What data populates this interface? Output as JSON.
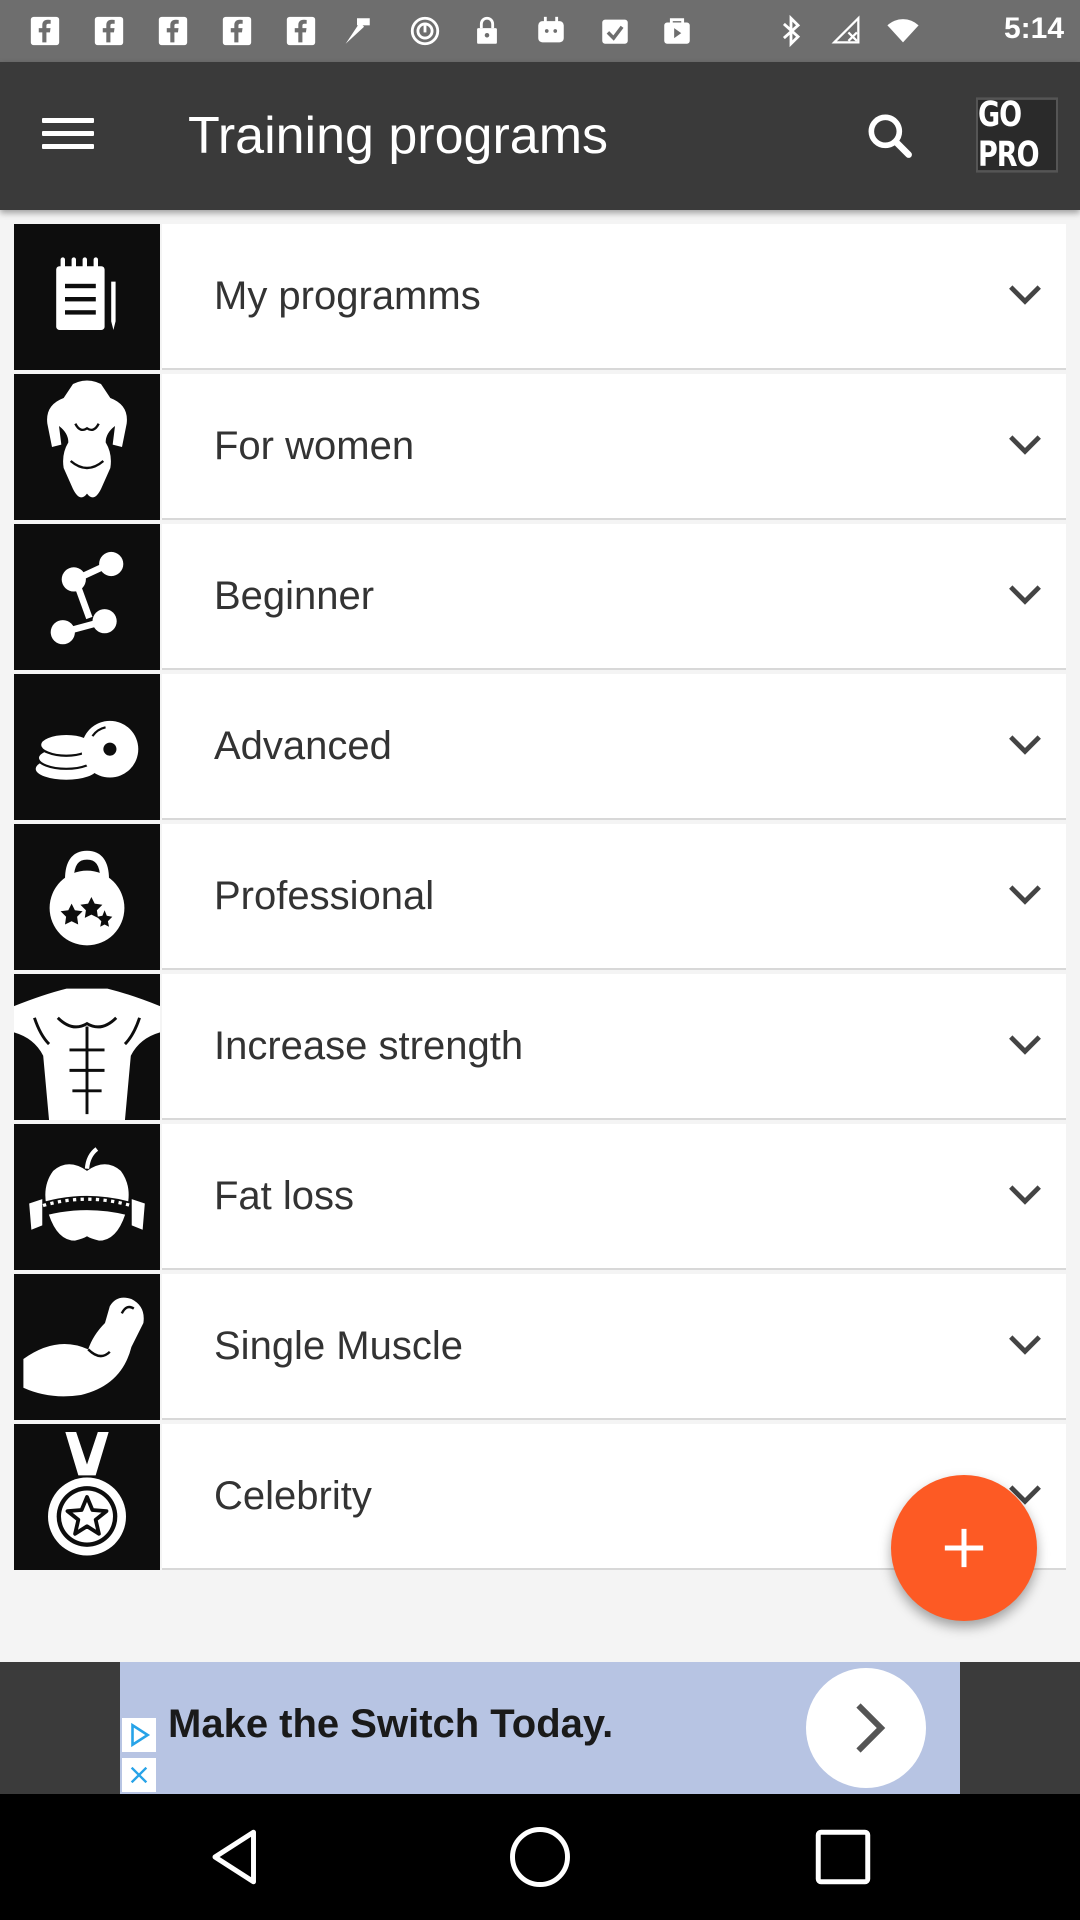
{
  "status_bar": {
    "time": "5:14",
    "left_icons": [
      "facebook-icon",
      "facebook-icon",
      "facebook-icon",
      "facebook-icon",
      "facebook-icon",
      "fe-icon",
      "alert-circle-icon",
      "lock-icon",
      "calendar-icon",
      "calendar-check-icon",
      "play-store-icon"
    ],
    "right_icons": [
      "bluetooth-icon",
      "no-signal-icon",
      "wifi-icon"
    ]
  },
  "app_bar": {
    "title": "Training programs",
    "menu_icon": "hamburger-menu-icon",
    "search_icon": "search-icon",
    "gopro_label": "GO PRO"
  },
  "programs": [
    {
      "label": "My programms",
      "icon": "notepad-icon"
    },
    {
      "label": "For women",
      "icon": "female-body-icon"
    },
    {
      "label": "Beginner",
      "icon": "dumbbells-icon"
    },
    {
      "label": "Advanced",
      "icon": "weight-plates-icon"
    },
    {
      "label": "Professional",
      "icon": "kettlebell-stars-icon"
    },
    {
      "label": "Increase strength",
      "icon": "muscular-torso-icon"
    },
    {
      "label": "Fat loss",
      "icon": "apple-tape-icon"
    },
    {
      "label": "Single Muscle",
      "icon": "flexed-arm-icon"
    },
    {
      "label": "Celebrity",
      "icon": "medal-star-icon"
    }
  ],
  "fab": {
    "icon": "plus-icon"
  },
  "ad": {
    "text": "Make the Switch Today.",
    "arrow_icon": "chevron-right-icon"
  },
  "colors": {
    "status_bar": "#6e6e6e",
    "app_bar": "#3a3a3a",
    "fab": "#fd5a24",
    "ad_background": "#b7c4e3"
  },
  "nav": {
    "back": "back-icon",
    "home": "home-icon",
    "recents": "recents-icon"
  }
}
